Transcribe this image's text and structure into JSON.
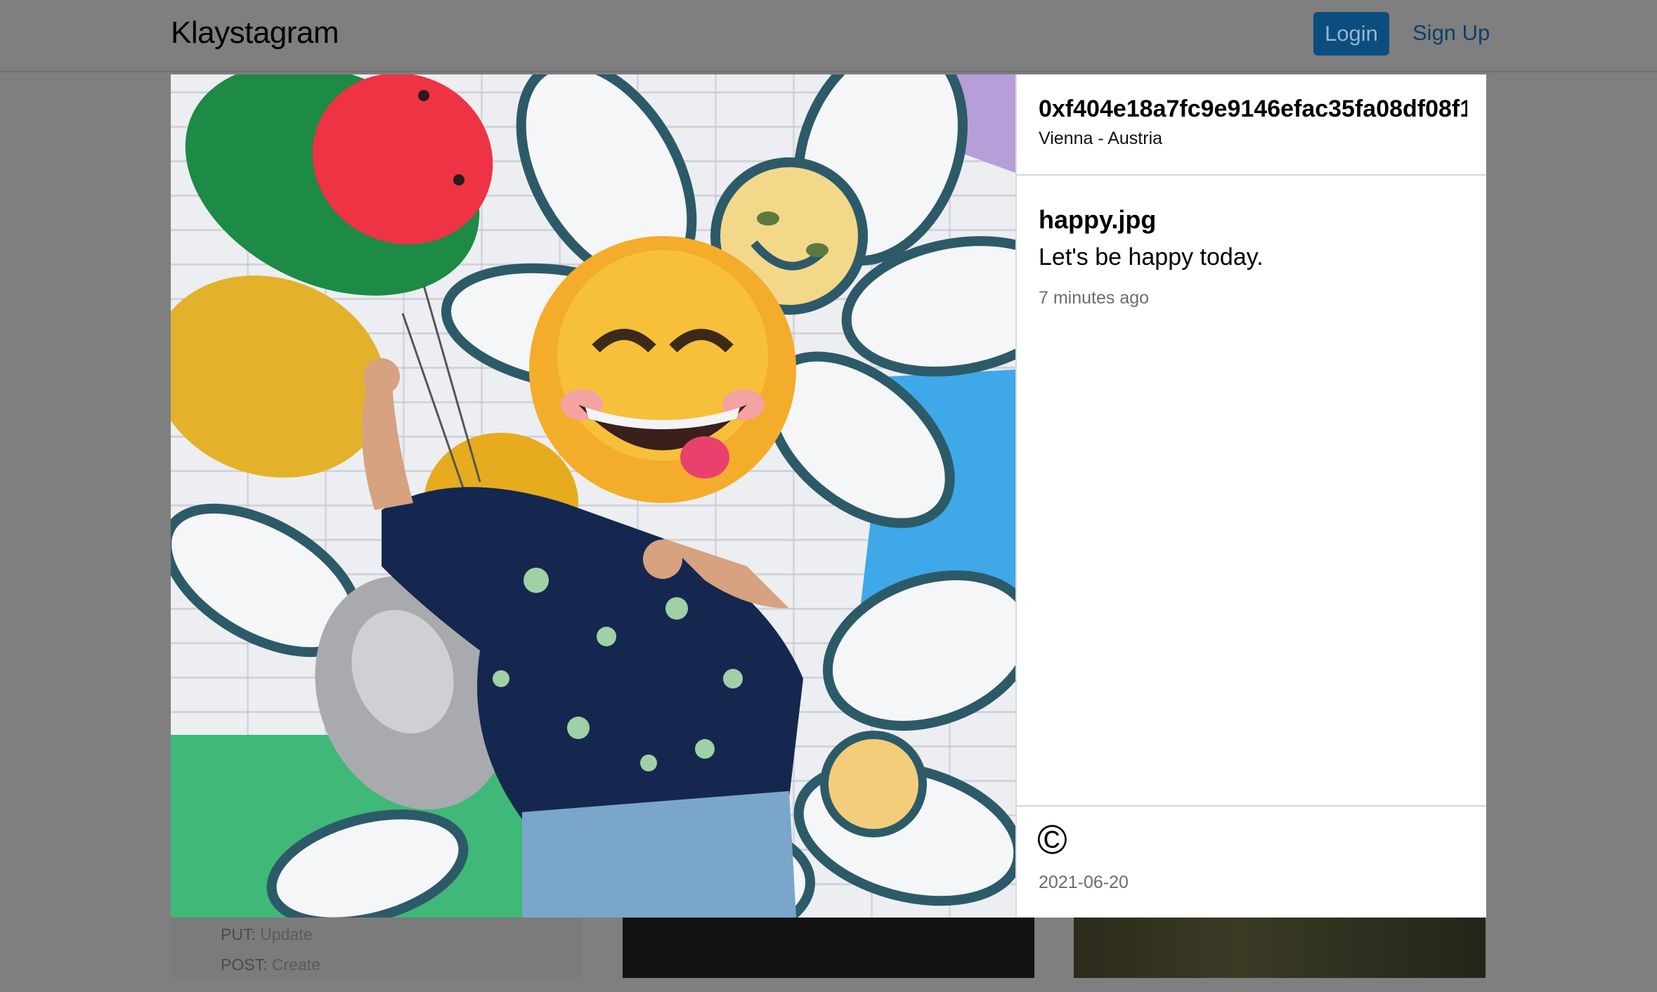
{
  "header": {
    "brand": "Klaystagram",
    "login_label": "Login",
    "signup_label": "Sign Up"
  },
  "background": {
    "api_lines": [
      {
        "method": "PUT:",
        "action": "Update"
      },
      {
        "method": "POST:",
        "action": "Create"
      }
    ]
  },
  "modal": {
    "photo_alt": "Person holding smiley face balloon in front of flower mural",
    "owner": "0xf404e18a7fc9e9146efac35fa08df08f1...",
    "location": "Vienna - Austria",
    "title": "happy.jpg",
    "description": "Let's be happy today.",
    "time_ago": "7 minutes ago",
    "copyright_symbol": "©",
    "date": "2021-06-20"
  },
  "colors": {
    "overlay": "#7f7f7f",
    "accent": "#0b4d7e",
    "link": "#0e3f66"
  }
}
